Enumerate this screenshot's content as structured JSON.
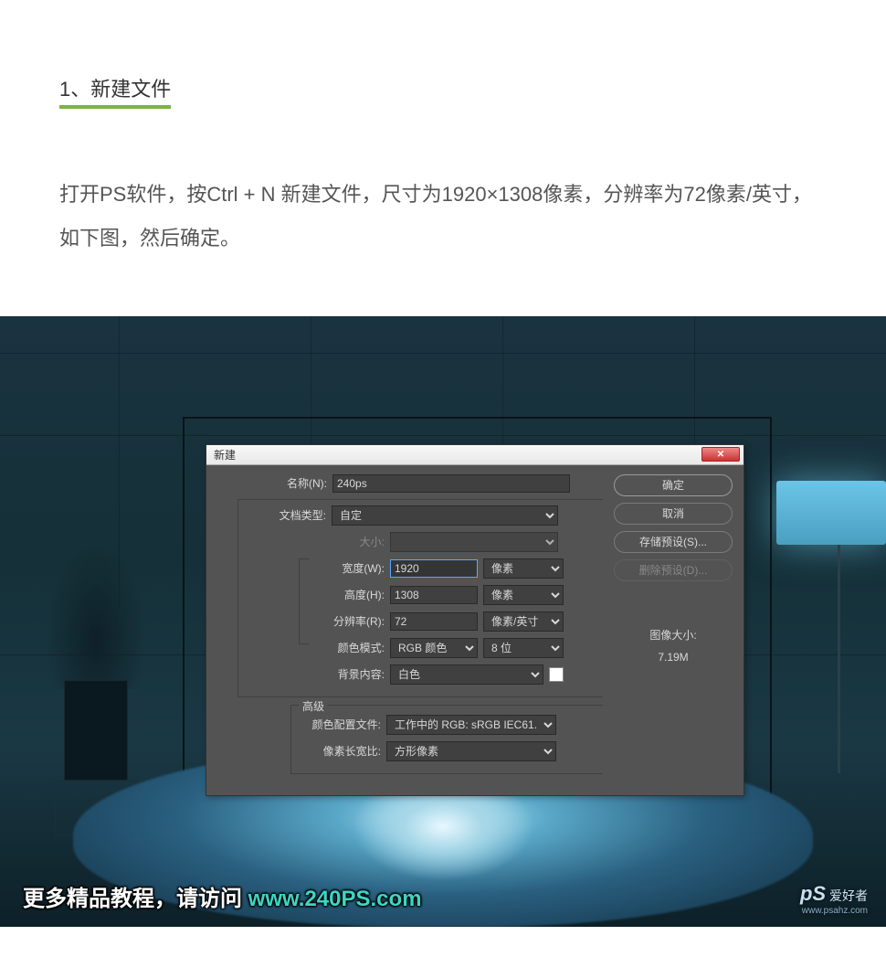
{
  "tutorial": {
    "step_title": "1、新建文件",
    "step_desc": "打开PS软件，按Ctrl + N 新建文件，尺寸为1920×1308像素，分辨率为72像素/英寸，如下图，然后确定。"
  },
  "dialog": {
    "title": "新建",
    "labels": {
      "name": "名称(N):",
      "doc_type": "文档类型:",
      "size": "大小:",
      "width": "宽度(W):",
      "height": "高度(H):",
      "resolution": "分辨率(R):",
      "color_mode": "颜色模式:",
      "bg_content": "背景内容:",
      "advanced": "高级",
      "color_profile": "颜色配置文件:",
      "pixel_ratio": "像素长宽比:"
    },
    "values": {
      "name": "240ps",
      "doc_type": "自定",
      "width": "1920",
      "height": "1308",
      "resolution": "72",
      "unit_px": "像素",
      "unit_res": "像素/英寸",
      "color_mode": "RGB 颜色",
      "bit_depth": "8 位",
      "bg_content": "白色",
      "color_profile": "工作中的 RGB: sRGB IEC61...",
      "pixel_ratio": "方形像素"
    },
    "buttons": {
      "ok": "确定",
      "cancel": "取消",
      "save_preset": "存储预设(S)...",
      "delete_preset": "删除预设(D)..."
    },
    "info": {
      "size_label": "图像大小:",
      "size_value": "7.19M"
    }
  },
  "footer": {
    "text_prefix": "更多精品教程，请访问 ",
    "url": "www.240PS.com"
  },
  "logo": {
    "brand_ps": "pS",
    "brand_cn": "爱好者",
    "url": "www.psahz.com"
  }
}
